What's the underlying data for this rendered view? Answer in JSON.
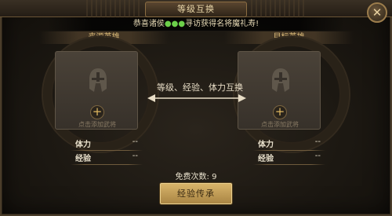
{
  "window": {
    "title": "等级互换",
    "close_glyph": "✕"
  },
  "announcement": {
    "prefix": "恭喜诸侯",
    "player": "●●●",
    "suffix": "寻访获得名将魔礼寿!"
  },
  "source_panel": {
    "header": "来源英雄",
    "slot_hint": "点击添加武将",
    "stats": [
      {
        "label": "体力",
        "value": "--"
      },
      {
        "label": "经验",
        "value": "--"
      }
    ]
  },
  "target_panel": {
    "header": "目标英雄",
    "slot_hint": "点击添加武将",
    "stats": [
      {
        "label": "体力",
        "value": "--"
      },
      {
        "label": "经验",
        "value": "--"
      }
    ]
  },
  "swap": {
    "label": "等级、经验、体力互换"
  },
  "free_count": {
    "text": "免费次数: 9"
  },
  "action_button": {
    "label": "经验传承"
  },
  "icons": {
    "slot_placeholder": "helmet-icon",
    "add": "plus-icon",
    "swap": "double-arrow-icon",
    "close": "close-icon"
  },
  "colors": {
    "gold_text": "#d9b877",
    "button_gold": "#d8b46a",
    "highlight_green": "#6ccf4a"
  }
}
